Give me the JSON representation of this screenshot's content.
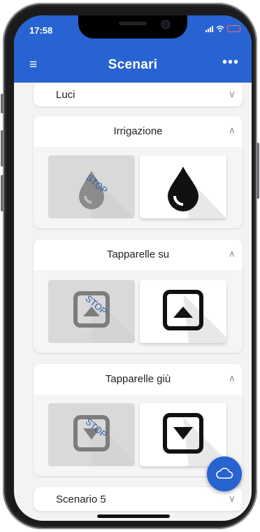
{
  "status_bar": {
    "time": "17:58"
  },
  "app_bar": {
    "title": "Scenari",
    "menu_icon": "≡",
    "more_icon": "•••"
  },
  "sections": [
    {
      "label": "Luci",
      "expanded": false
    },
    {
      "label": "Irrigazione",
      "expanded": true,
      "off_label": "STOP"
    },
    {
      "label": "Tapparelle su",
      "expanded": true,
      "off_label": "STOP"
    },
    {
      "label": "Tapparelle giù",
      "expanded": true,
      "off_label": "STOP"
    },
    {
      "label": "Scenario 5",
      "expanded": false
    }
  ],
  "icons": {
    "menu": "hamburger-menu-icon",
    "more": "more-options-icon",
    "expand": "chevron-down-icon",
    "collapse": "chevron-up-icon",
    "water": "water-drop-icon",
    "up": "arrow-up-square-icon",
    "down": "arrow-down-square-icon",
    "cloud": "cloud-icon"
  },
  "colors": {
    "accent": "#2863d2",
    "background": "#f3f3f3",
    "card": "#ffffff",
    "stop_text": "#2a5db4"
  }
}
